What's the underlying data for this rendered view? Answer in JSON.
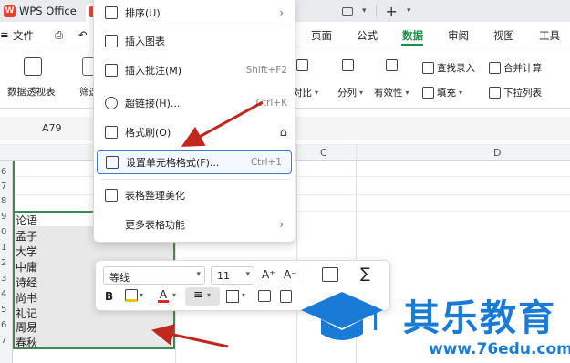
{
  "titlebar": {
    "app_tab": "WPS Office"
  },
  "menu": {
    "file": "文件",
    "tabs": [
      "页面",
      "公式",
      "数据",
      "审阅",
      "视图",
      "工具"
    ],
    "active_tab": "数据"
  },
  "ribbon": {
    "pivot": "数据透视表",
    "filter": "筛选",
    "split_compare": "对比",
    "split": "分列",
    "validity": "有效性",
    "fill": "填充",
    "lookup": "查找录入",
    "merge_calc": "合并计算",
    "dropdown_list": "下拉列表"
  },
  "formula_bar": {
    "name_box": "A79"
  },
  "sheet": {
    "columns": [
      "C",
      "D"
    ],
    "row_numbers": [
      "6",
      "7",
      "8",
      "9",
      "0",
      "1",
      "2",
      "3",
      "4",
      "5",
      "6",
      "7"
    ],
    "cells": [
      "论语",
      "孟子",
      "大学",
      "中庸",
      "诗经",
      "尚书",
      "礼记",
      "周易",
      "春秋"
    ]
  },
  "context_menu": {
    "items": [
      {
        "label": "排序(U)",
        "shortcut": "",
        "submenu": true
      },
      {
        "label": "插入图表",
        "shortcut": "",
        "submenu": false
      },
      {
        "label": "插入批注(M)",
        "shortcut": "Shift+F2",
        "submenu": false
      },
      {
        "label": "超链接(H)...",
        "shortcut": "Ctrl+K",
        "submenu": false
      },
      {
        "label": "格式刷(O)",
        "shortcut": "",
        "submenu": false
      },
      {
        "label": "设置单元格格式(F)...",
        "shortcut": "Ctrl+1",
        "submenu": false,
        "highlighted": true
      },
      {
        "label": "表格整理美化",
        "shortcut": "",
        "submenu": false
      },
      {
        "label": "更多表格功能",
        "shortcut": "",
        "submenu": true
      }
    ]
  },
  "mini_toolbar": {
    "font_name": "等线",
    "font_size": "11",
    "increase_font": "A⁺",
    "decrease_font": "A⁻",
    "bold": "B",
    "align_symbol": "≡",
    "sum_symbol": "∑"
  },
  "watermark": {
    "text": "其乐教育",
    "url": "www.76edu.com"
  },
  "colors": {
    "accent_green": "#1f8a4c",
    "highlight_blue": "#3b7ad9",
    "arrow_red": "#c0281e",
    "watermark_blue": "#1a7bd6"
  }
}
